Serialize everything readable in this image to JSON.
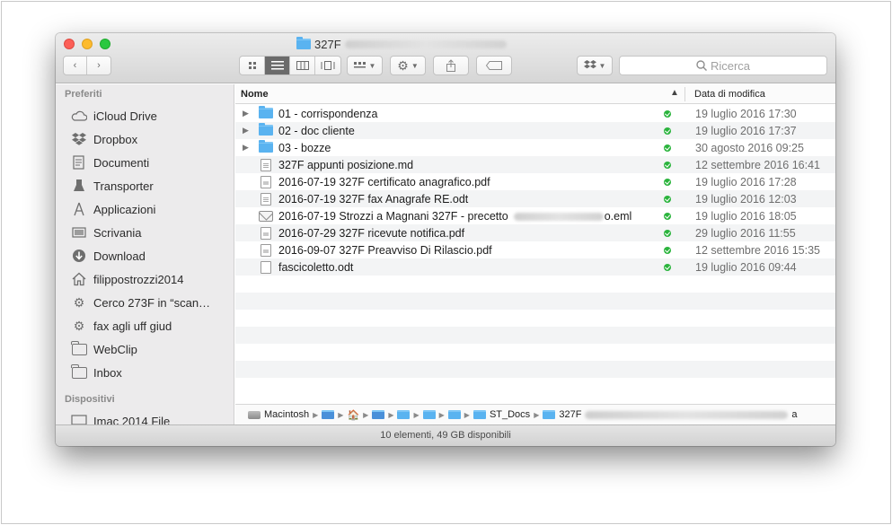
{
  "window": {
    "title": "327F",
    "status": "10 elementi, 49 GB disponibili"
  },
  "toolbar": {
    "search_placeholder": "Ricerca",
    "view_icons": [
      "icon-view-icon",
      "list-view-icon",
      "column-view-icon",
      "coverflow-view-icon"
    ]
  },
  "sidebar": {
    "favorites_header": "Preferiti",
    "devices_header": "Dispositivi",
    "favorites": [
      {
        "label": "iCloud Drive",
        "icon": "cloud-icon"
      },
      {
        "label": "Dropbox",
        "icon": "dropbox-icon"
      },
      {
        "label": "Documenti",
        "icon": "documents-icon"
      },
      {
        "label": "Transporter",
        "icon": "transporter-icon"
      },
      {
        "label": "Applicazioni",
        "icon": "applications-icon"
      },
      {
        "label": "Scrivania",
        "icon": "desktop-icon"
      },
      {
        "label": "Download",
        "icon": "download-icon"
      },
      {
        "label": "filippostrozzi2014",
        "icon": "home-icon"
      },
      {
        "label": "Cerco 273F in “scan…",
        "icon": "smart-folder-icon"
      },
      {
        "label": "fax agli uff giud",
        "icon": "smart-folder-icon"
      },
      {
        "label": "WebClip",
        "icon": "folder-icon"
      },
      {
        "label": "Inbox",
        "icon": "folder-icon"
      }
    ],
    "devices": [
      {
        "label": "Imac 2014 File",
        "icon": "display-icon"
      }
    ]
  },
  "columns": {
    "name": "Nome",
    "date": "Data di modifica"
  },
  "files": [
    {
      "name": "01 - corrispondenza",
      "date": "19 luglio 2016 17:30",
      "type": "folder"
    },
    {
      "name": "02 - doc cliente",
      "date": "19 luglio 2016 17:37",
      "type": "folder"
    },
    {
      "name": "03 - bozze",
      "date": "30 agosto 2016 09:25",
      "type": "folder"
    },
    {
      "name": "327F appunti posizione.md",
      "date": "12 settembre 2016 16:41",
      "type": "md"
    },
    {
      "name": "2016-07-19 327F certificato anagrafico.pdf",
      "date": "19 luglio 2016 17:28",
      "type": "pdf"
    },
    {
      "name": "2016-07-19 327F fax Anagrafe RE.odt",
      "date": "19 luglio 2016 12:03",
      "type": "doc"
    },
    {
      "name": "2016-07-19 Strozzi a Magnani 327F - precetto",
      "name_suffix": "o.eml",
      "date": "19 luglio 2016 18:05",
      "type": "eml"
    },
    {
      "name": "2016-07-29 327F ricevute notifica.pdf",
      "date": "29 luglio 2016 11:55",
      "type": "pdf"
    },
    {
      "name": "2016-09-07 327F Preavviso Di Rilascio.pdf",
      "date": "12 settembre 2016 15:35",
      "type": "pdf"
    },
    {
      "name": "fascicoletto.odt",
      "date": "19 luglio 2016 09:44",
      "type": "doc"
    }
  ],
  "pathbar": {
    "disk": "Macintosh",
    "st_docs": "ST_Docs",
    "current": "327F",
    "current_suffix": "a"
  }
}
